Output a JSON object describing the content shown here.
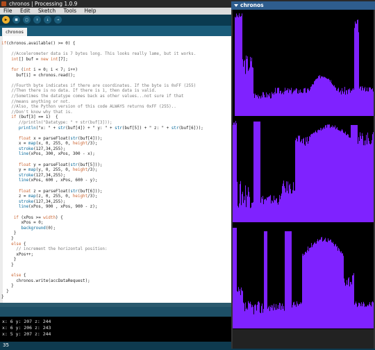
{
  "ide": {
    "title": "chronos | Processing 1.0.9",
    "menu": [
      "File",
      "Edit",
      "Sketch",
      "Tools",
      "Help"
    ],
    "tab": "chronos",
    "line_number": "35"
  },
  "console": {
    "lines": [
      "x: 6 y: 207 z: 244",
      "x: 6 y: 206 z: 243",
      "x: 5 y: 207 z: 244"
    ]
  },
  "sketch": {
    "title": "chronos"
  },
  "colors": {
    "plot": "#7f22ff",
    "toolbar": "#0a3a50",
    "run": "#f0b02c"
  }
}
